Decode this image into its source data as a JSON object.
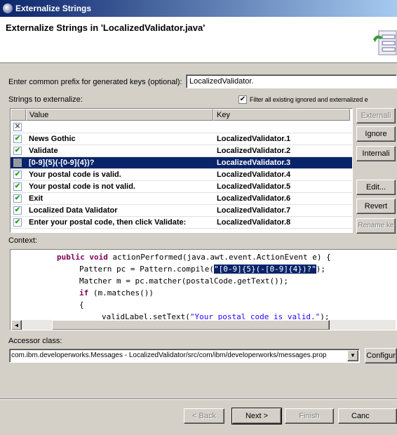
{
  "window": {
    "title": "Externalize Strings"
  },
  "header": {
    "title": "Externalize Strings in 'LocalizedValidator.java'"
  },
  "prefix": {
    "label": "Enter common prefix for generated keys (optional):",
    "value": "LocalizedValidator."
  },
  "strings_label": "Strings to externalize:",
  "filter": {
    "label": "Filter all existing ignored and externalized e",
    "checked": true
  },
  "table": {
    "columns": [
      "Value",
      "Key"
    ],
    "rows": [
      {
        "state": "ignored",
        "value": "",
        "key": ""
      },
      {
        "state": "checked",
        "value": "News Gothic",
        "key": "LocalizedValidator.1"
      },
      {
        "state": "checked",
        "value": "Validate",
        "key": "LocalizedValidator.2"
      },
      {
        "state": "mixed",
        "value": "[0-9]{5}(-[0-9]{4})?",
        "key": "LocalizedValidator.3",
        "selected": true
      },
      {
        "state": "checked",
        "value": "Your postal code is valid.",
        "key": "LocalizedValidator.4"
      },
      {
        "state": "checked",
        "value": "Your postal code is not valid.",
        "key": "LocalizedValidator.5"
      },
      {
        "state": "checked",
        "value": "Exit",
        "key": "LocalizedValidator.6"
      },
      {
        "state": "checked",
        "value": "Localized Data Validator",
        "key": "LocalizedValidator.7"
      },
      {
        "state": "checked",
        "value": "Enter your postal code, then click Validate:",
        "key": "LocalizedValidator.8"
      }
    ]
  },
  "side_buttons": {
    "externalize": "Externali",
    "ignore": "Ignore",
    "internalize": "Internali",
    "edit": "Edit...",
    "revert": "Revert",
    "rename": "Rename ke"
  },
  "context": {
    "label": "Context:",
    "lines": {
      "l1_kw": "public void",
      "l1": " actionPerformed(java.awt.event.ActionEvent e) {",
      "l2a": "Pattern pc = Pattern.compile(",
      "l2_hl": "\"[0-9]{5}(-[0-9]{4})?\"",
      "l2b": ");",
      "l3": "Matcher m = pc.matcher(postalCode.getText());",
      "l4_kw": "if",
      "l4": " (m.matches())",
      "l5": "{",
      "l6a": "validLabel.setText(",
      "l6_str": "\"Your postal code is valid.\"",
      "l6b": ");"
    }
  },
  "accessor": {
    "label": "Accessor class:",
    "value": "com.ibm.developerworks.Messages - LocalizedValidator/src/com/ibm/developerworks/messages.prop",
    "configure": "Configur"
  },
  "footer": {
    "back": "< Back",
    "next": "Next >",
    "finish": "Finish",
    "cancel": "Canc"
  }
}
